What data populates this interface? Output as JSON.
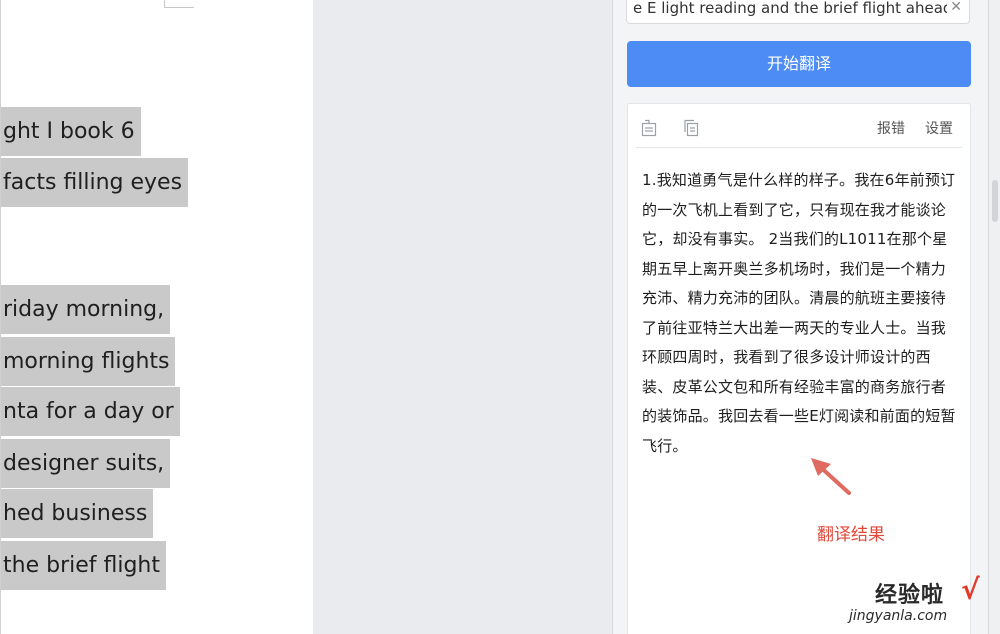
{
  "document": {
    "lines": [
      "ght I book 6",
      "facts filling eyes",
      "riday morning,",
      "morning flights",
      "nta for a day or",
      " designer suits,",
      "hed business",
      "the brief flight"
    ]
  },
  "translator": {
    "source_text": "e E light reading and the brief flight ahead.",
    "translate_button": "开始翻译",
    "toolbar": {
      "report_error": "报错",
      "settings": "设置"
    },
    "result_text": "1.我知道勇气是什么样的样子。我在6年前预订的一次飞机上看到了它，只有现在我才能谈论它，却没有事实。 2当我们的L1011在那个星期五早上离开奥兰多机场时，我们是一个精力充沛、精力充沛的团队。清晨的航班主要接待了前往亚特兰大出差一两天的专业人士。当我环顾四周时，我看到了很多设计师设计的西装、皮革公文包和所有经验丰富的商务旅行者的装饰品。我回去看一些E灯阅读和前面的短暂飞行。"
  },
  "annotation": {
    "label": "翻译结果",
    "color": "#e04a3a"
  },
  "watermark": {
    "title": "经验啦",
    "url": "jingyanla.com"
  },
  "colors": {
    "accent": "#4d8cf5",
    "highlight": "#c9c9c9"
  }
}
